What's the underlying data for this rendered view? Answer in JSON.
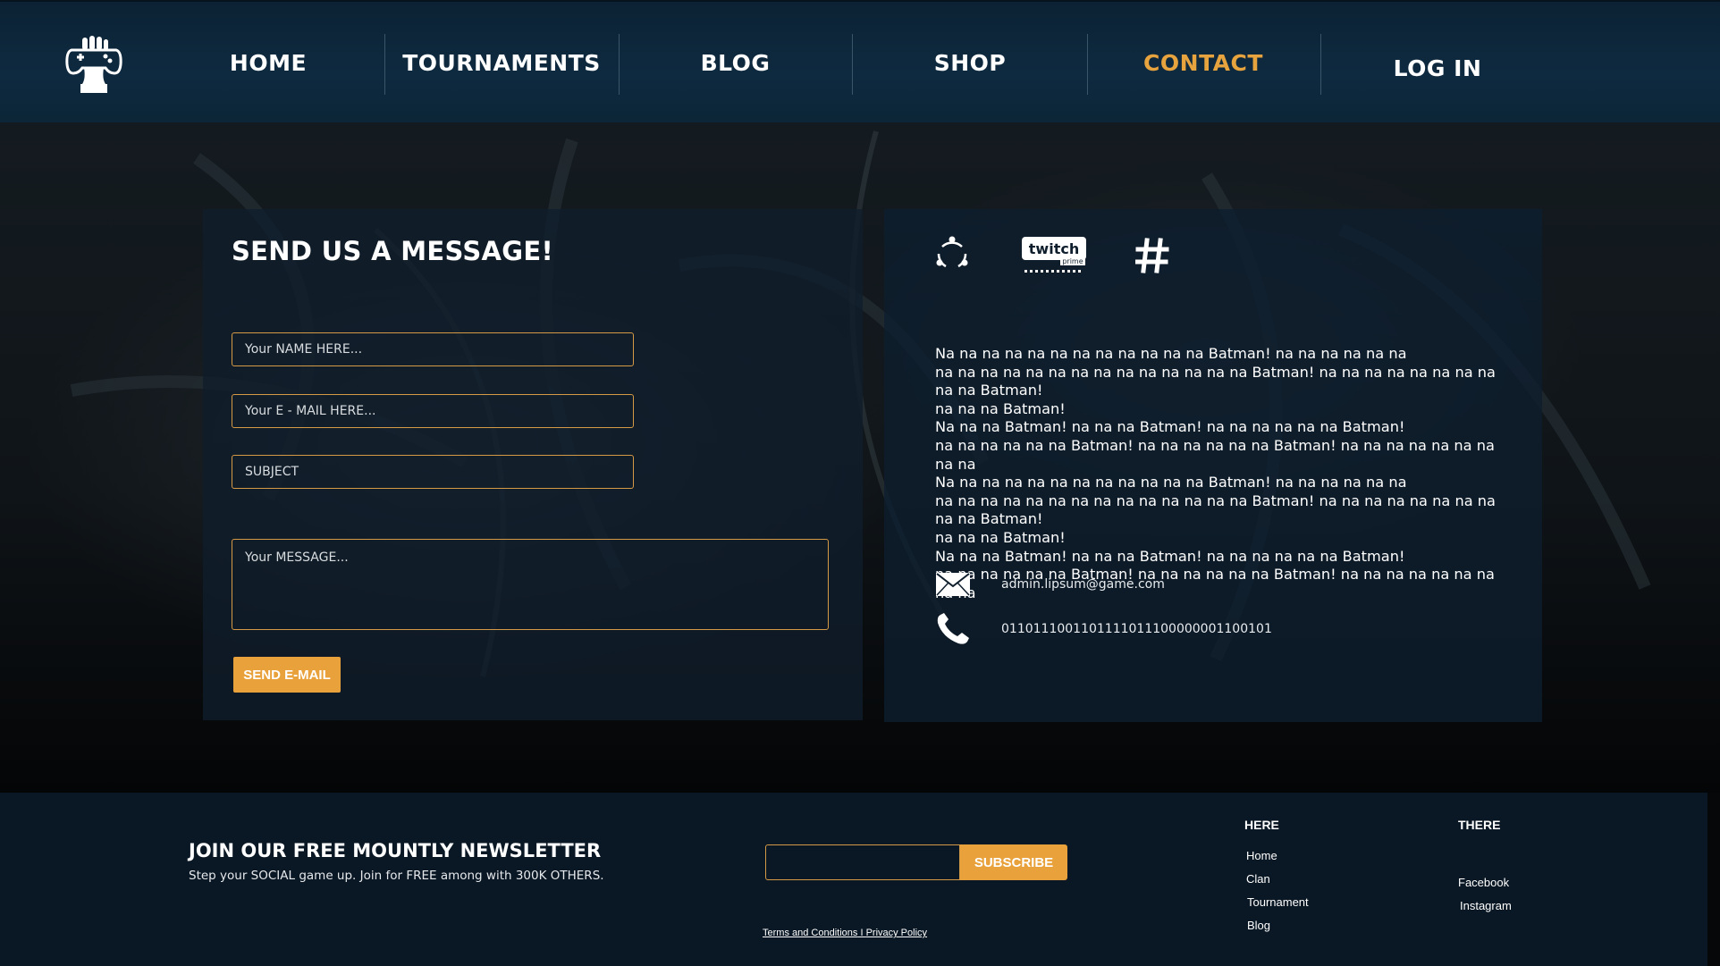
{
  "nav": {
    "items": [
      {
        "label": "HOME"
      },
      {
        "label": "TOURNAMENTS"
      },
      {
        "label": "BLOG"
      },
      {
        "label": "SHOP"
      },
      {
        "label": "CONTACT"
      },
      {
        "label": "LOG IN"
      }
    ],
    "active": "CONTACT",
    "logo_icon": "gamepad-hand-icon"
  },
  "form": {
    "title": "SEND US A MESSAGE!",
    "name_placeholder": "Your NAME HERE...",
    "email_placeholder": "Your E - MAIL HERE...",
    "subject_placeholder": "SUBJECT",
    "message_placeholder": "Your MESSAGE...",
    "send_label": "SEND E-MAIL"
  },
  "info": {
    "social_icons": [
      "network-icon",
      "twitch-prime-icon",
      "hashtag-icon"
    ],
    "text": "Na na na na na na na na na na na na Batman! na na na na na na\nna na na na na na na na na na na na na na Batman! na na na na na na na na na na Batman!\nna na na Batman!\nNa na na Batman! na na na Batman! na na na na na na Batman!\nna na na na na na Batman! na na na na na na Batman! na na na na na na na na na\nNa na na na na na na na na na na na Batman! na na na na na na\nna na na na na na na na na na na na na na Batman! na na na na na na na na na na Batman!\nna na na Batman!\nNa na na Batman! na na na Batman! na na na na na na Batman!\nna na na na na na Batman! na na na na na na Batman! na na na na na na na na na",
    "email": "admin.lipsum@game.com",
    "phone": "0110111001101111011100000001100101"
  },
  "footer": {
    "newsletter_title": "JOIN OUR FREE MOUNTLY NEWSLETTER",
    "newsletter_sub": "Step your SOCIAL game up. Join for FREE among with 300K OTHERS.",
    "subscribe_label": "SUBSCRIBE",
    "terms": "Terms and Conditions",
    "separator": " I ",
    "privacy": "Privacy Policy",
    "col1": {
      "heading": "HERE",
      "links": [
        "Home",
        "Clan",
        "Tournament",
        "Blog"
      ]
    },
    "col2": {
      "heading": "THERE",
      "links": [
        "Facebook",
        "Instagram"
      ]
    }
  },
  "colors": {
    "accent": "#e9a23b",
    "nav_bg": "#0e2a40",
    "panel_bg": "#101e2c",
    "footer_bg": "#0a1724"
  }
}
